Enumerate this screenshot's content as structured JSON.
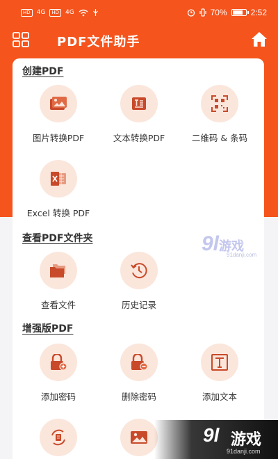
{
  "status_bar": {
    "left_badges": [
      "HD",
      "HD",
      "4G",
      "4G"
    ],
    "battery": "70%",
    "battery_level": 0.7,
    "time": "2:52"
  },
  "header": {
    "title": "PDF文件助手",
    "menu_icon": "grid-menu-icon",
    "home_icon": "home-icon"
  },
  "sections": [
    {
      "title": "创建PDF",
      "items": [
        {
          "label": "图片转换PDF",
          "icon": "image-icon"
        },
        {
          "label": "文本转换PDF",
          "icon": "text-doc-icon"
        },
        {
          "label": "二维码 & 条码",
          "icon": "qr-scan-icon"
        },
        {
          "label": "Excel 转换 PDF",
          "icon": "excel-icon"
        }
      ]
    },
    {
      "title": "查看PDF文件夹",
      "items": [
        {
          "label": "查看文件",
          "icon": "folder-icon"
        },
        {
          "label": "历史记录",
          "icon": "history-icon"
        }
      ]
    },
    {
      "title": "增强版PDF",
      "items": [
        {
          "label": "添加密码",
          "icon": "lock-add-icon"
        },
        {
          "label": "删除密码",
          "icon": "lock-remove-icon"
        },
        {
          "label": "添加文本",
          "icon": "add-text-icon"
        },
        {
          "label": "",
          "icon": "rotate-doc-icon"
        },
        {
          "label": "",
          "icon": "image-icon"
        }
      ]
    }
  ],
  "watermark": {
    "number": "9l",
    "name": "游戏",
    "domain_mid": "91danji.com",
    "domain_corner": "91danji.com"
  },
  "colors": {
    "accent": "#f5541d",
    "icon_bg": "#fbe6dc",
    "icon_fg": "#c84a2a"
  }
}
